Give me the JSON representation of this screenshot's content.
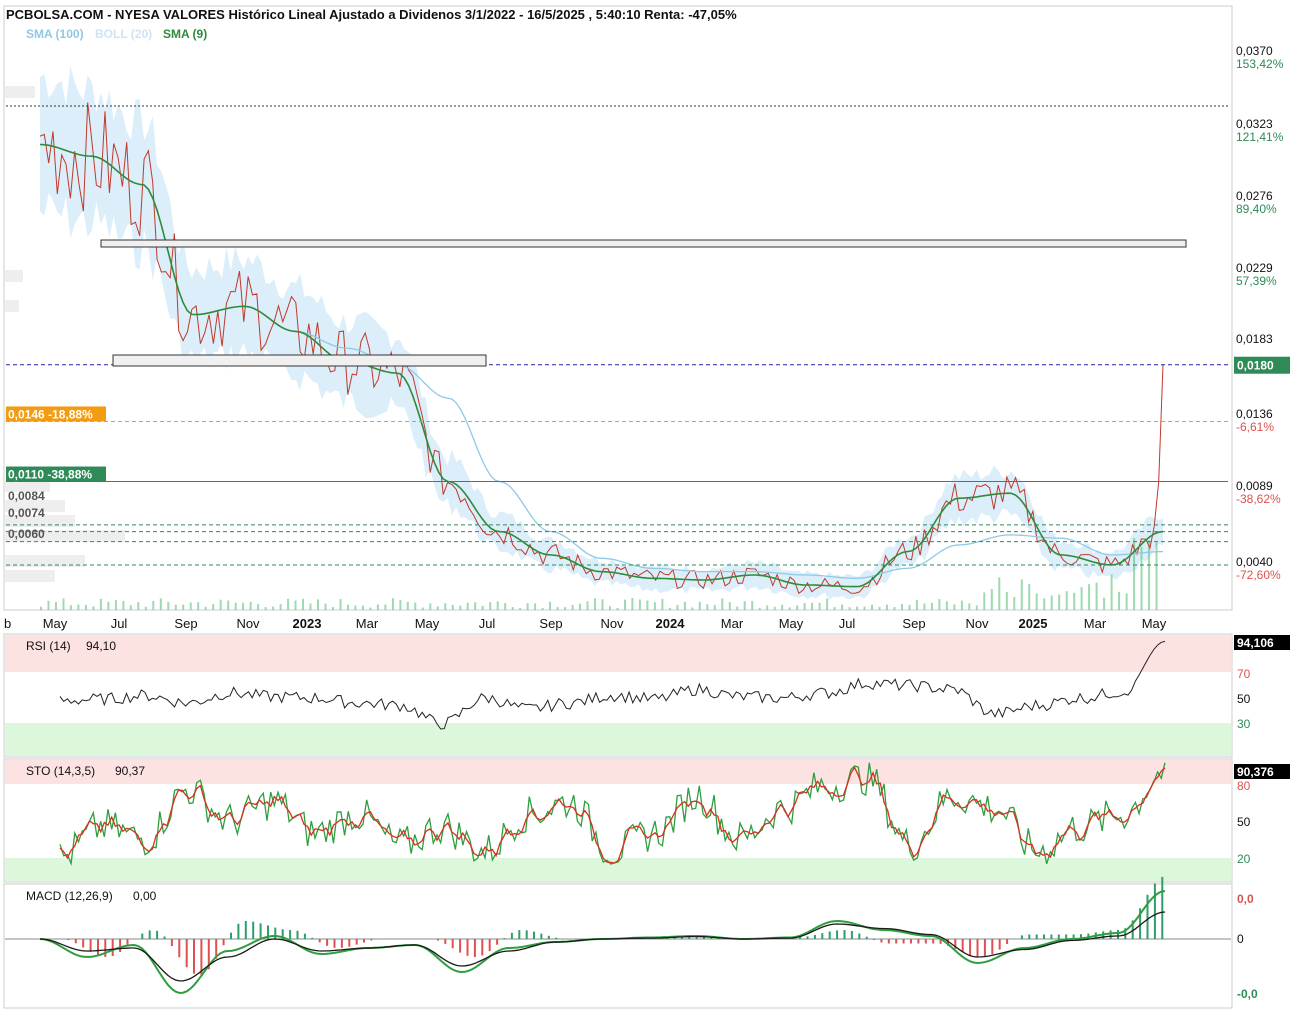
{
  "header": {
    "title": "PCBOLSA.COM - NYESA VALORES Histórico Lineal Ajustado a Dividenos 3/1/2022 - 16/5/2025 , 5:40:10 Renta: -47,05%",
    "legend": [
      {
        "label": "SMA (100)",
        "color": "#8ecae6"
      },
      {
        "label": "BOLL (20)",
        "color": "#cfe3f5"
      },
      {
        "label": "SMA (9)",
        "color": "#2e8b3a"
      }
    ]
  },
  "colors": {
    "price": "#c0392b",
    "sma9": "#2e8b3a",
    "sma100": "#8ecae6",
    "boll": "#cfe8f7",
    "volume": "#5dbf7a",
    "axis": "#000000",
    "rsi": "#222222",
    "sto_k": "#2e9e3e",
    "sto_d": "#d6301f",
    "macd_line": "#2e9e3e",
    "macd_signal": "#1a1a1a",
    "hist_pos": "#2e9e6b",
    "hist_neg": "#e05050",
    "overbought_zone": "#fde2e2",
    "oversold_zone": "#ddf7dd",
    "last_price_badge": "#2e8b57",
    "level_146": "#f39c12",
    "level_110": "#2e8b57"
  },
  "x_axis": {
    "labels": [
      "b",
      "May",
      "Jul",
      "Sep",
      "Nov",
      "2023",
      "Mar",
      "May",
      "Jul",
      "Sep",
      "Nov",
      "2024",
      "Mar",
      "May",
      "Jul",
      "Sep",
      "Nov",
      "2025",
      "Mar",
      "May"
    ],
    "bold_labels": [
      "2023",
      "2024",
      "2025"
    ]
  },
  "price_axis": {
    "ticks": [
      {
        "price": "0,0370",
        "pct": "153,42%",
        "pct_color": "#2e8b57"
      },
      {
        "price": "0,0323",
        "pct": "121,41%",
        "pct_color": "#2e8b57"
      },
      {
        "price": "0,0276",
        "pct": "89,40%",
        "pct_color": "#2e8b57"
      },
      {
        "price": "0,0229",
        "pct": "57,39%",
        "pct_color": "#2e8b57"
      },
      {
        "price": "0,0183",
        "pct": "",
        "pct_color": "#2e8b57"
      },
      {
        "price": "0,0136",
        "pct": "-6,61%",
        "pct_color": "#d9534f"
      },
      {
        "price": "0,0089",
        "pct": "-38,62%",
        "pct_color": "#d9534f"
      },
      {
        "price": "0,0040",
        "pct": "-72,60%",
        "pct_color": "#d9534f"
      }
    ],
    "last_price": "0,0180"
  },
  "levels": {
    "left_labels": [
      {
        "text": "0,0146 -18,88%",
        "color": "#f39c12"
      },
      {
        "text": "0,0110 -38,88%",
        "color": "#2e8b57"
      },
      {
        "text": "0,0084",
        "color": "#555555"
      },
      {
        "text": "0,0074",
        "color": "#555555"
      },
      {
        "text": "0,0060",
        "color": "#555555"
      }
    ]
  },
  "chart_data": [
    {
      "type": "line",
      "name": "Price",
      "y_range": [
        0.0033,
        0.0395
      ],
      "x": [
        "2022-03",
        "2022-05",
        "2022-06",
        "2022-07",
        "2022-09",
        "2022-11",
        "2023-01",
        "2023-03",
        "2023-04",
        "2023-05",
        "2023-07",
        "2023-09",
        "2023-11",
        "2024-01",
        "2024-03",
        "2024-05",
        "2024-07",
        "2024-09",
        "2024-11",
        "2024-12",
        "2025-01",
        "2025-03",
        "2025-05"
      ],
      "series": [
        {
          "name": "SMA (9)",
          "values": [
            0.0312,
            0.0305,
            0.0288,
            0.021,
            0.0215,
            0.02,
            0.0182,
            0.0175,
            0.011,
            0.008,
            0.0066,
            0.0056,
            0.0052,
            0.0051,
            0.0054,
            0.0048,
            0.0047,
            0.0068,
            0.01,
            0.0103,
            0.0066,
            0.006,
            0.008
          ]
        },
        {
          "name": "SMA (100)",
          "values": [
            null,
            null,
            null,
            null,
            0.0215,
            0.02,
            0.019,
            0.018,
            0.016,
            0.011,
            0.008,
            0.0064,
            0.0058,
            0.0056,
            0.0056,
            0.0054,
            0.0052,
            0.0058,
            0.0072,
            0.0078,
            0.0076,
            0.0066,
            0.0068
          ]
        }
      ],
      "last_value": 0.018
    },
    {
      "type": "line",
      "title": "RSI (14)",
      "current": "94,10",
      "current_badge": "94,106",
      "ylim": [
        0,
        100
      ],
      "levels": [
        "70",
        "50",
        "30"
      ],
      "values": [
        46,
        47,
        50,
        44,
        52,
        49,
        48,
        44,
        42,
        27,
        48,
        39,
        44,
        50,
        47,
        55,
        49,
        48,
        52,
        60,
        58,
        55,
        35,
        42,
        48,
        53,
        94
      ]
    },
    {
      "type": "line",
      "title": "STO (14,3,5)",
      "current": "90,37",
      "current_badge": "90,376",
      "ylim": [
        0,
        100
      ],
      "levels": [
        "80",
        "50",
        "20"
      ],
      "series": [
        {
          "name": "%K",
          "values": [
            20,
            45,
            35,
            75,
            50,
            65,
            40,
            55,
            30,
            45,
            25,
            55,
            65,
            25,
            40,
            70,
            35,
            60,
            78,
            85,
            30,
            70,
            60,
            25,
            45,
            55,
            90
          ]
        },
        {
          "name": "%D",
          "values": [
            22,
            40,
            38,
            68,
            52,
            60,
            42,
            50,
            32,
            42,
            28,
            50,
            60,
            28,
            42,
            65,
            38,
            58,
            75,
            80,
            35,
            66,
            58,
            28,
            42,
            52,
            85
          ]
        }
      ]
    },
    {
      "type": "line",
      "title": "MACD (12,26,9)",
      "current": "0,00",
      "axis_labels": [
        "0,0",
        "0",
        "-0,0"
      ],
      "series": [
        {
          "name": "MACD",
          "values": [
            0.0,
            -0.6,
            -0.2,
            -1.8,
            -0.4,
            0.1,
            -0.5,
            -0.3,
            -0.2,
            -1.1,
            -0.3,
            -0.1,
            0.0,
            0.05,
            0.1,
            0.0,
            0.05,
            0.6,
            0.3,
            0.1,
            -0.8,
            -0.3,
            0.0,
            0.2,
            1.6
          ]
        },
        {
          "name": "Signal",
          "values": [
            0.0,
            -0.4,
            -0.3,
            -1.4,
            -0.6,
            0.0,
            -0.4,
            -0.3,
            -0.2,
            -0.9,
            -0.4,
            -0.1,
            0.0,
            0.03,
            0.08,
            0.0,
            0.03,
            0.5,
            0.35,
            0.15,
            -0.6,
            -0.35,
            -0.05,
            0.1,
            0.9
          ]
        }
      ]
    }
  ]
}
